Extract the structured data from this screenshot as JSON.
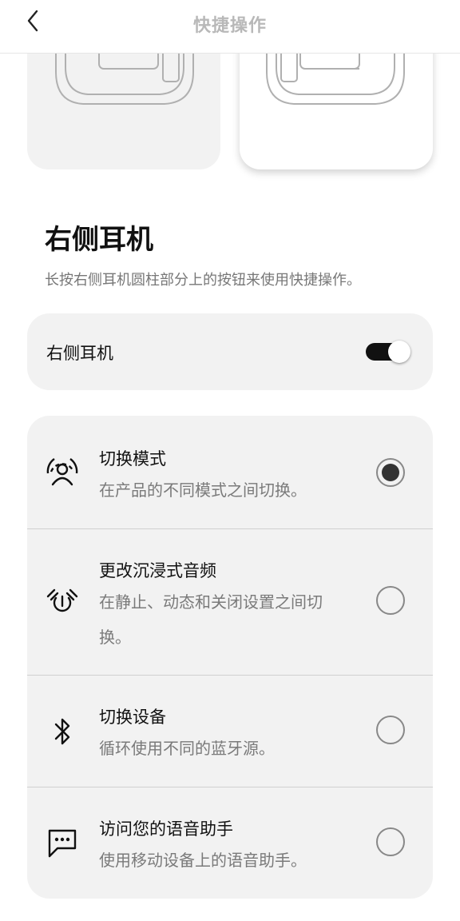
{
  "header": {
    "title": "快捷操作",
    "back_icon": "chevron-left-icon"
  },
  "section": {
    "title": "右侧耳机",
    "description": "长按右侧耳机圆柱部分上的按钮来使用快捷操作。"
  },
  "toggle": {
    "label": "右侧耳机",
    "on": true
  },
  "options": [
    {
      "title": "切换模式",
      "description": "在产品的不同模式之间切换。",
      "icon": "listening-mode-icon",
      "selected": true
    },
    {
      "title": "更改沉浸式音频",
      "description_line1": "在静止、动态和关闭设置之间切",
      "description_line2": "换。",
      "icon": "immersive-audio-icon",
      "selected": false
    },
    {
      "title": "切换设备",
      "description": "循环使用不同的蓝牙源。",
      "icon": "bluetooth-icon",
      "selected": false
    },
    {
      "title": "访问您的语音助手",
      "description": "使用移动设备上的语音助手。",
      "icon": "voice-assistant-icon",
      "selected": false
    }
  ],
  "colors": {
    "toggle_on": "#111111",
    "card_bg": "#f2f2f2",
    "muted_text": "#777777"
  }
}
